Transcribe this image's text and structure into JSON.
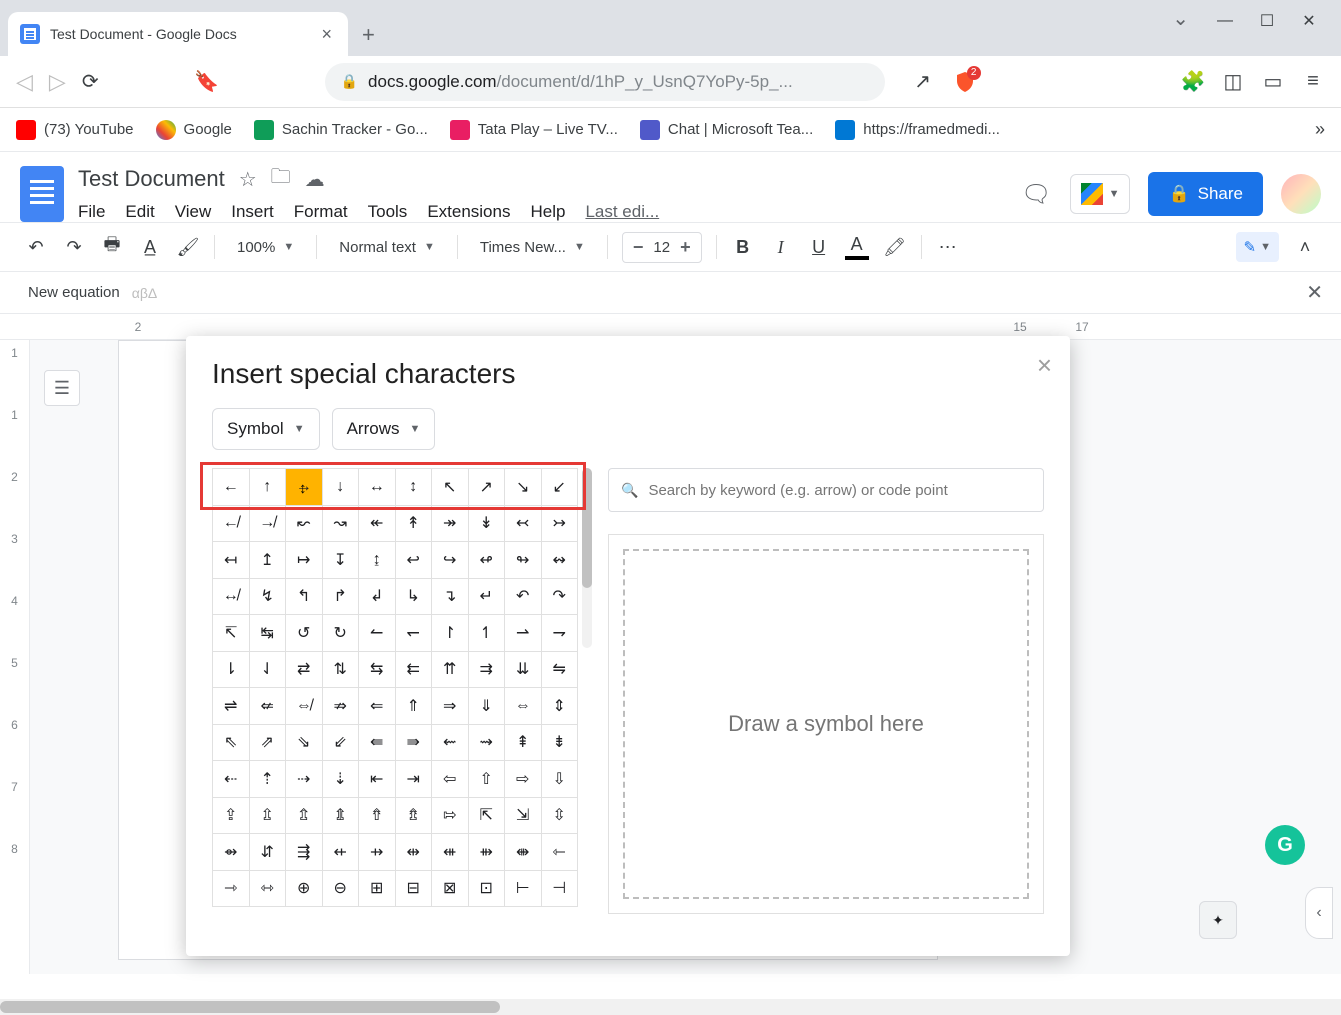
{
  "browser": {
    "tab_title": "Test Document - Google Docs",
    "url_host": "docs.google.com",
    "url_path": "/document/d/1hP_y_UsnQ7YoPy-5p_...",
    "brave_badge": "2"
  },
  "bookmarks": {
    "yt": "(73) YouTube",
    "google": "Google",
    "sheet": "Sachin Tracker - Go...",
    "tata": "Tata Play – Live TV...",
    "teams": "Chat | Microsoft Tea...",
    "onedrive": "https://framedmedi..."
  },
  "docs": {
    "title": "Test Document",
    "menu": {
      "file": "File",
      "edit": "Edit",
      "view": "View",
      "insert": "Insert",
      "format": "Format",
      "tools": "Tools",
      "extensions": "Extensions",
      "help": "Help",
      "last_edit": "Last edi..."
    },
    "share": "Share"
  },
  "toolbar": {
    "zoom": "100%",
    "style": "Normal text",
    "font": "Times New...",
    "size": "12"
  },
  "eqbar": {
    "label": "New equation"
  },
  "ruler_h": [
    "2",
    "15",
    "17"
  ],
  "ruler_v": [
    "1",
    "1",
    "2",
    "3",
    "4",
    "5",
    "6",
    "7",
    "8"
  ],
  "modal": {
    "title": "Insert special characters",
    "cat1": "Symbol",
    "cat2": "Arrows",
    "search_ph": "Search by keyword (e.g. arrow) or code point",
    "draw_label": "Draw a symbol here",
    "grid": [
      [
        "←",
        "↑",
        "→",
        "↓",
        "↔",
        "↕",
        "↖",
        "↗",
        "↘",
        "↙"
      ],
      [
        "↚",
        "↛",
        "↜",
        "↝",
        "↞",
        "↟",
        "↠",
        "↡",
        "↢",
        "↣"
      ],
      [
        "↤",
        "↥",
        "↦",
        "↧",
        "↨",
        "↩",
        "↪",
        "↫",
        "↬",
        "↭"
      ],
      [
        "↮",
        "↯",
        "↰",
        "↱",
        "↲",
        "↳",
        "↴",
        "↵",
        "↶",
        "↷"
      ],
      [
        "↸",
        "↹",
        "↺",
        "↻",
        "↼",
        "↽",
        "↾",
        "↿",
        "⇀",
        "⇁"
      ],
      [
        "⇂",
        "⇃",
        "⇄",
        "⇅",
        "⇆",
        "⇇",
        "⇈",
        "⇉",
        "⇊",
        "⇋"
      ],
      [
        "⇌",
        "⇍",
        "⇎",
        "⇏",
        "⇐",
        "⇑",
        "⇒",
        "⇓",
        "⇔",
        "⇕"
      ],
      [
        "⇖",
        "⇗",
        "⇘",
        "⇙",
        "⇚",
        "⇛",
        "⇜",
        "⇝",
        "⇞",
        "⇟"
      ],
      [
        "⇠",
        "⇡",
        "⇢",
        "⇣",
        "⇤",
        "⇥",
        "⇦",
        "⇧",
        "⇨",
        "⇩"
      ],
      [
        "⇪",
        "⇫",
        "⇬",
        "⇭",
        "⇮",
        "⇯",
        "⇰",
        "⇱",
        "⇲",
        "⇳"
      ],
      [
        "⇴",
        "⇵",
        "⇶",
        "⇷",
        "⇸",
        "⇹",
        "⇺",
        "⇻",
        "⇼",
        "⇽"
      ],
      [
        "⇾",
        "⇿",
        "⊕",
        "⊖",
        "⊞",
        "⊟",
        "⊠",
        "⊡",
        "⊢",
        "⊣"
      ]
    ],
    "highlight": {
      "row": 0,
      "col": 2
    }
  }
}
